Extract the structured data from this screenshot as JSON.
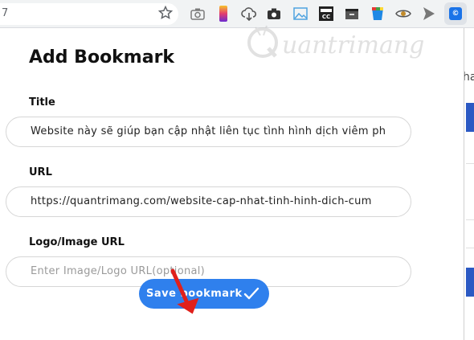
{
  "browser": {
    "url_fragment": "7",
    "star_icon": "bookmark-star-icon",
    "extensions": [
      "camera-icon",
      "gradient-bar-icon",
      "cloud-download-icon",
      "camera-solid-icon",
      "image-icon",
      "toolbar-box-icon",
      "folder-icon",
      "color-cup-icon",
      "eye-icon",
      "send-icon",
      "active-extension-icon"
    ],
    "extension_label": "©"
  },
  "background_page": {
    "side_text": "ha"
  },
  "watermark": {
    "text": "uantrimang"
  },
  "popup": {
    "title": "Add Bookmark",
    "fields": {
      "title": {
        "label": "Title",
        "value": "Website này sẽ giúp bạn cập nhật liên tục tình hình dịch viêm ph"
      },
      "url": {
        "label": "URL",
        "value": "https://quantrimang.com/website-cap-nhat-tinh-hinh-dich-cum"
      },
      "logo": {
        "label": "Logo/Image URL",
        "placeholder": "Enter Image/Logo URL(optional)"
      }
    },
    "save_label": "Save bookmark"
  },
  "colors": {
    "accent": "#2f80ed",
    "arrow": "#e0201b"
  }
}
